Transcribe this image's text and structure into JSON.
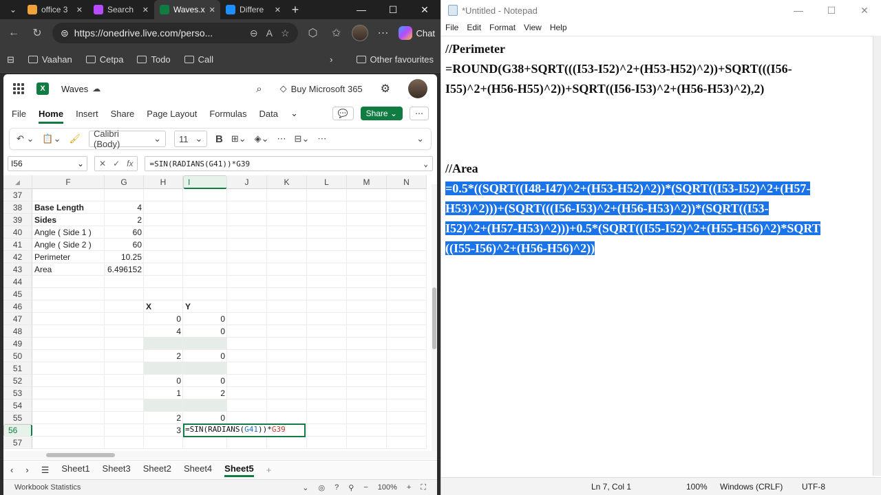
{
  "browser": {
    "tabs": [
      {
        "label": "office 3",
        "icon": "search-tab-icon",
        "color": "#f0a33a"
      },
      {
        "label": "Search",
        "icon": "copilot-tab-icon",
        "color": "#b64bff"
      },
      {
        "label": "Waves.x",
        "icon": "excel-tab-icon",
        "color": "#107c41",
        "active": true
      },
      {
        "label": "Differe",
        "icon": "onedrive-tab-icon",
        "color": "#1e8fff"
      }
    ],
    "url": "https://onedrive.live.com/perso...",
    "chat_label": "Chat",
    "favourites": [
      "Vaahan",
      "Cetpa",
      "Todo",
      "Call"
    ],
    "other_favourites": "Other favourites"
  },
  "excel": {
    "filename": "Waves",
    "buy_label": "Buy Microsoft 365",
    "menu": [
      "File",
      "Home",
      "Insert",
      "Share",
      "Page Layout",
      "Formulas",
      "Data"
    ],
    "active_menu": "Home",
    "share_label": "Share",
    "font_name": "Calibri (Body)",
    "font_size": "11",
    "namebox": "I56",
    "formula": "=SIN(RADIANS(G41))*G39",
    "columns": [
      "F",
      "G",
      "H",
      "I",
      "J",
      "K",
      "L",
      "M",
      "N"
    ],
    "rows": [
      "37",
      "38",
      "39",
      "40",
      "41",
      "42",
      "43",
      "44",
      "45",
      "46",
      "47",
      "48",
      "49",
      "50",
      "51",
      "52",
      "53",
      "54",
      "55",
      "56",
      "57"
    ],
    "labels": {
      "r38": "Base Length",
      "r39": "Sides",
      "r40": "Angle ( Side 1 )",
      "r41": "Angle ( Side 2 )",
      "r42": "Perimeter",
      "r43": "Area"
    },
    "values": {
      "r38": "4",
      "r39": "2",
      "r40": "60",
      "r41": "60",
      "r42": "10.25",
      "r43": "6.496152"
    },
    "xy_header": {
      "x": "X",
      "y": "Y"
    },
    "xy": {
      "r47": [
        "0",
        "0"
      ],
      "r48": [
        "4",
        "0"
      ],
      "r50": [
        "2",
        "0"
      ],
      "r52": [
        "0",
        "0"
      ],
      "r53": [
        "1",
        "2"
      ],
      "r55": [
        "2",
        "0"
      ],
      "r56": [
        "3",
        ""
      ]
    },
    "active_cell_text": {
      "pre": "=SIN(RADIANS(",
      "ref1": "G41",
      "mid": "))*",
      "ref2": "G39"
    },
    "sheets": [
      "Sheet1",
      "Sheet3",
      "Sheet2",
      "Sheet4",
      "Sheet5"
    ],
    "active_sheet": "Sheet5",
    "status_left": "Workbook Statistics",
    "zoom": "100%"
  },
  "notepad": {
    "title": "*Untitled - Notepad",
    "menu": [
      "File",
      "Edit",
      "Format",
      "View",
      "Help"
    ],
    "lines": [
      {
        "text": "//Perimeter",
        "hl": false
      },
      {
        "text": "=ROUND(G38+SQRT(((I53-I52)^2+(H53-H52)^2))+SQRT(((I56-",
        "hl": false
      },
      {
        "text": "I55)^2+(H56-H55)^2))+SQRT((I56-I53)^2+(H56-H53)^2),2)",
        "hl": false
      },
      {
        "text": "",
        "hl": false
      },
      {
        "text": "",
        "hl": false
      },
      {
        "text": "",
        "hl": false
      },
      {
        "text": "//Area",
        "hl": false
      },
      {
        "text": "=0.5*((SQRT((I48-I47)^2+(H53-H52)^2))*(SQRT((I53-I52)^2+(H57-",
        "hl": true
      },
      {
        "text": "H53)^2)))+(SQRT(((I56-I53)^2+(H56-H53)^2))*(SQRT((I53-",
        "hl": true
      },
      {
        "text": "I52)^2+(H57-H53)^2)))+0.5*(SQRT((I55-I52)^2+(H55-H56)^2)*SQRT",
        "hl": true
      },
      {
        "text": "((I55-I56)^2+(H56-H56)^2))",
        "hl": true
      }
    ],
    "status": {
      "pos": "Ln 7, Col 1",
      "zoom": "100%",
      "eol": "Windows (CRLF)",
      "enc": "UTF-8"
    }
  }
}
